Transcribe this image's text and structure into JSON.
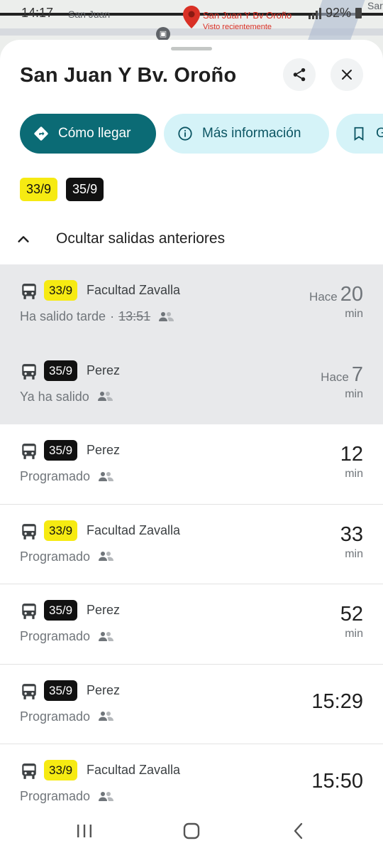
{
  "status_bar": {
    "time": "14:17",
    "battery": "92%"
  },
  "map": {
    "street_left": "San Juan",
    "street_right": "Sar",
    "pin_label": "San Juan Y Bv Oroño",
    "pin_sub": "Visto recientemente"
  },
  "sheet": {
    "title": "San Juan Y Bv. Oroño",
    "actions": {
      "directions_label": "Cómo llegar",
      "info_label": "Más información",
      "save_label": "G"
    },
    "routes": [
      "33/9",
      "35/9"
    ],
    "toggle_label": "Ocultar salidas anteriores"
  },
  "departures": [
    {
      "route": "33/9",
      "route_color": "yellow",
      "destination": "Facultad Zavalla",
      "status": "Ha salido tarde",
      "separator": "·",
      "scheduled": "13:51",
      "prefix": "Hace",
      "time": "20",
      "unit": "min",
      "past": true
    },
    {
      "route": "35/9",
      "route_color": "black",
      "destination": "Perez",
      "status": "Ya ha salido",
      "prefix": "Hace",
      "time": "7",
      "unit": "min",
      "past": true
    },
    {
      "route": "35/9",
      "route_color": "black",
      "destination": "Perez",
      "status": "Programado",
      "time": "12",
      "unit": "min",
      "past": false
    },
    {
      "route": "33/9",
      "route_color": "yellow",
      "destination": "Facultad Zavalla",
      "status": "Programado",
      "time": "33",
      "unit": "min",
      "past": false
    },
    {
      "route": "35/9",
      "route_color": "black",
      "destination": "Perez",
      "status": "Programado",
      "time": "52",
      "unit": "min",
      "past": false
    },
    {
      "route": "35/9",
      "route_color": "black",
      "destination": "Perez",
      "status": "Programado",
      "clock": "15:29",
      "past": false
    },
    {
      "route": "33/9",
      "route_color": "yellow",
      "destination": "Facultad Zavalla",
      "status": "Programado",
      "clock": "15:50",
      "past": false
    }
  ],
  "colors": {
    "primary_teal": "#0b6b75",
    "chip_bg": "#d5f3f8",
    "route_yellow": "#f6ea12",
    "route_black": "#111111"
  }
}
